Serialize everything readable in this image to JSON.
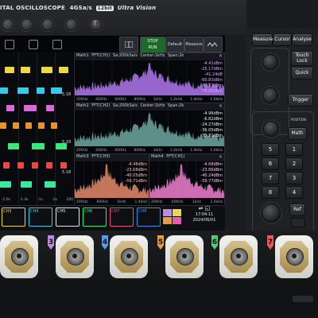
{
  "header": {
    "title": "ITAL OSCILLOSCOPE",
    "rate": "4GSa/s",
    "bits": "12bit",
    "series": "Ultra Vision"
  },
  "toolbar": {
    "stop_label": "STOP",
    "run_label": "RUN",
    "default_label": "Default",
    "measure_label": "Measure"
  },
  "fft_panels": [
    {
      "title": "Math1",
      "src": "FFT(CH1)",
      "rate": "Sa:200kSa/s",
      "center": "Center:1kHz",
      "span": "Span:2k",
      "values": [
        "-4.41dBm",
        "-25.17dBm",
        "-41.24dB",
        "-60.83dBm",
        "-68.72dBm",
        "-79.05dBm"
      ],
      "axis": [
        "200Hz",
        "400Hz",
        "600Hz",
        "800Hz",
        "1kHz",
        "1.2kHz",
        "1.4kHz",
        "1.6kHz"
      ],
      "color": "#b277f0"
    },
    {
      "title": "Math2",
      "src": "FFT(CH2)",
      "rate": "Sa:200kSa/s",
      "center": "Center:1kHz",
      "span": "Span:2k",
      "values": [
        "-4.96dBm",
        "-6.82dBm",
        "-24.27dBm",
        "-36.05dBm",
        "-55.21dBm"
      ],
      "axis": [
        "200Hz",
        "400Hz",
        "600Hz",
        "800Hz",
        "1kHz",
        "1.2kHz",
        "1.4kHz",
        "1.6kHz"
      ],
      "color": "#6fa8a0"
    },
    {
      "title": "Math3",
      "src": "FFT(CH3)",
      "values": [
        "-4.48dBm",
        "-23.68dBm",
        "-40.05dBm",
        "-59.71dBm"
      ],
      "axis": [
        "200Hz",
        "600Hz",
        "1kHz",
        "1.4kHz"
      ],
      "color": "#e58a6a"
    },
    {
      "title": "Math4",
      "src": "FFT(CH1)",
      "values": [
        "-4.68dBm",
        "-23.86dBm",
        "-40.24dBm",
        "-59.77dBm"
      ],
      "axis": [
        "200Hz",
        "600Hz",
        "1kHz",
        "1.4kHz"
      ],
      "color": "#f07fd0"
    }
  ],
  "wave_axis": [
    "-1.6s",
    "-1.4s",
    "-1s",
    "-1s",
    "200"
  ],
  "channels": [
    {
      "name": "CH3",
      "color": "#e8d84a"
    },
    {
      "name": "CH4",
      "color": "#3ac8e8"
    },
    {
      "name": "CH5",
      "color": "#e8e8e8"
    },
    {
      "name": "CH6",
      "color": "#3ae87a"
    },
    {
      "name": "CH7",
      "color": "#e84a7a"
    },
    {
      "name": "CH8",
      "color": "#3a8ae8"
    }
  ],
  "wave_labels": [
    "5.18",
    "5.18",
    "5.18"
  ],
  "clock": {
    "time": "17:04:11",
    "date": "2024/06/01"
  },
  "panel": {
    "measure": "Measure",
    "cursor": "Cursor",
    "analyse": "Analyse",
    "touch": "Touch Lock",
    "quick": "Quick",
    "trigger": "Trigger",
    "math": "Math",
    "ref": "Ref",
    "position": "POSITION",
    "keys": [
      "1",
      "2",
      "3",
      "4",
      "5",
      "6",
      "7",
      "8"
    ]
  },
  "front": {
    "connector_numbers": [
      {
        "n": "3",
        "color": "#c08ae0"
      },
      {
        "n": "4",
        "color": "#5a9ae8"
      },
      {
        "n": "5",
        "color": "#e89a4a"
      },
      {
        "n": "6",
        "color": "#5ac87a"
      },
      {
        "n": "7",
        "color": "#e85a5a"
      }
    ]
  }
}
